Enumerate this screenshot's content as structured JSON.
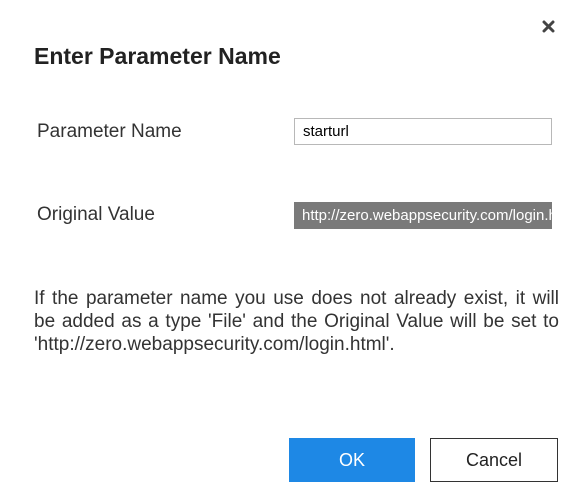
{
  "dialog": {
    "title": "Enter Parameter Name",
    "close_icon": "close-icon",
    "parameter_name_label": "Parameter Name",
    "parameter_name_value": "starturl",
    "original_value_label": "Original Value",
    "original_value": "http://zero.webappsecurity.com/login.html",
    "info_text": "If the parameter name you use does not already exist, it will be added as a type 'File' and the Original Value will be set to 'http://zero.webappsecurity.com/login.html'.",
    "ok_label": "OK",
    "cancel_label": "Cancel"
  },
  "colors": {
    "ok_button": "#1e88e5",
    "original_value_bg": "#7a7a7a"
  }
}
